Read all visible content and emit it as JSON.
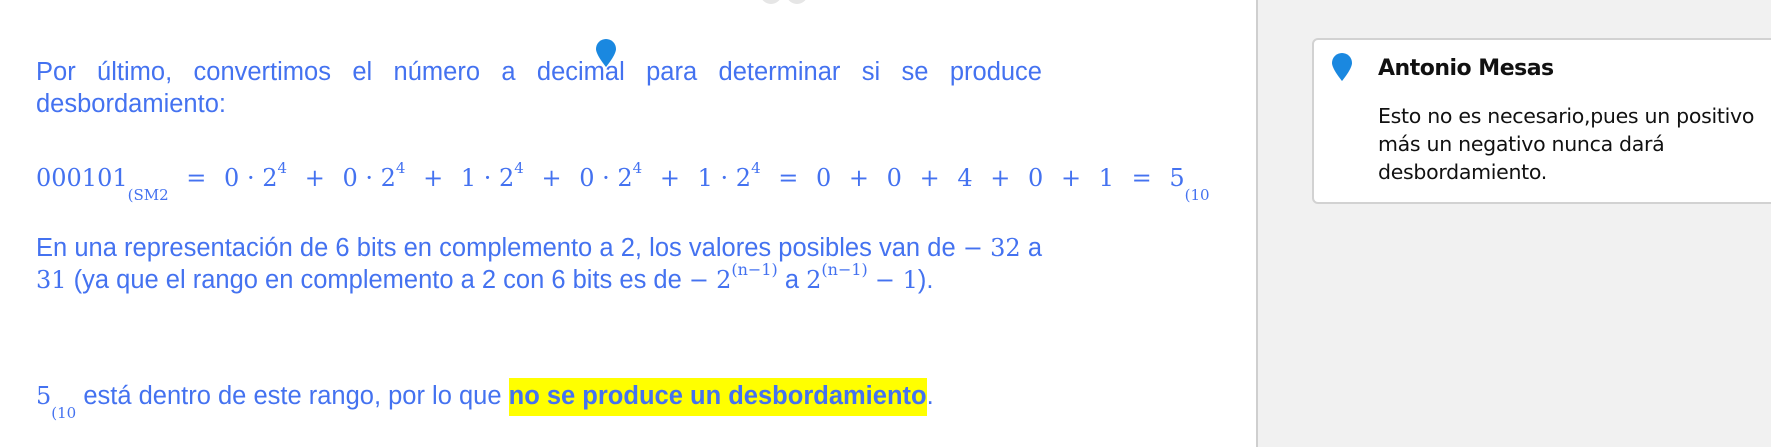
{
  "document": {
    "paragraph1": "Por último, convertimos el número a decimal para determinar si se produce desbordamiento:",
    "equation": {
      "lhs_number": "000101",
      "lhs_base": "(SM2",
      "terms": [
        {
          "digit": "0",
          "base": "2",
          "exp": "4"
        },
        {
          "digit": "0",
          "base": "2",
          "exp": "4"
        },
        {
          "digit": "1",
          "base": "2",
          "exp": "4"
        },
        {
          "digit": "0",
          "base": "2",
          "exp": "4"
        },
        {
          "digit": "1",
          "base": "2",
          "exp": "4"
        }
      ],
      "sum_terms": [
        "0",
        "0",
        "4",
        "0",
        "1"
      ],
      "result": "5",
      "result_base": "(10"
    },
    "paragraph2": {
      "line1": "En una representación de 6 bits en complemento a 2, los valores posibles  van de",
      "minus_sign": "−",
      "range_low": "32",
      "word_a1": "a",
      "range_high": "31",
      "mid_text": "(ya que el rango en complemento a 2 con 6 bits es de",
      "base": "2",
      "exponent": "(n−1)",
      "word_a2": "a",
      "tail_math": "− 1",
      "close": ")."
    },
    "paragraph3": {
      "value": "5",
      "value_base": "(10",
      "text": "está dentro de este rango, por lo que ",
      "highlight": "no se produce un desbordamiento",
      "end": "."
    }
  },
  "comment": {
    "author": "Antonio Mesas",
    "text": "Esto no es necesario,pues un positivo más un negativo nunca dará desbordamiento."
  },
  "colors": {
    "text_blue": "#4472f0",
    "highlight_yellow": "#ffff00",
    "pin_blue": "#1a88e0",
    "margin_pane_bg": "#f1f1f1"
  },
  "icons": {
    "anchor": "comment-pin-icon",
    "card": "comment-pin-icon"
  }
}
